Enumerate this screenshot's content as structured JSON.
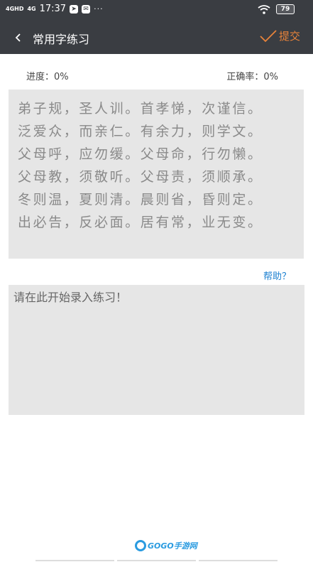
{
  "status_bar": {
    "network_top": "4GHD",
    "network_bottom": "4G",
    "time": "17:37",
    "notification_icons": [
      "navigation-icon",
      "mail-icon"
    ],
    "more": "···",
    "battery": "79"
  },
  "header": {
    "title": "常用字练习",
    "submit_label": "提交",
    "accent_color": "#e8833a",
    "bg_color": "#3a3d42"
  },
  "progress": {
    "progress_label": "进度：0%",
    "accuracy_label": "正确率：0%"
  },
  "practice_text": {
    "lines": [
      "弟子规，圣人训。首孝悌，次谨信。",
      "泛爱众，而亲仁。有余力，则学文。",
      "父母呼，应勿缓。父母命，行勿懒。",
      "父母教，须敬听。父母责，须顺承。",
      "冬则温，夏则清。晨则省，昏则定。",
      "出必告，反必面。居有常，业无变。"
    ]
  },
  "help_link": "帮助？",
  "input": {
    "placeholder": "请在此开始录入练习！",
    "value": ""
  },
  "watermark": {
    "text": "GOGO手游网"
  }
}
